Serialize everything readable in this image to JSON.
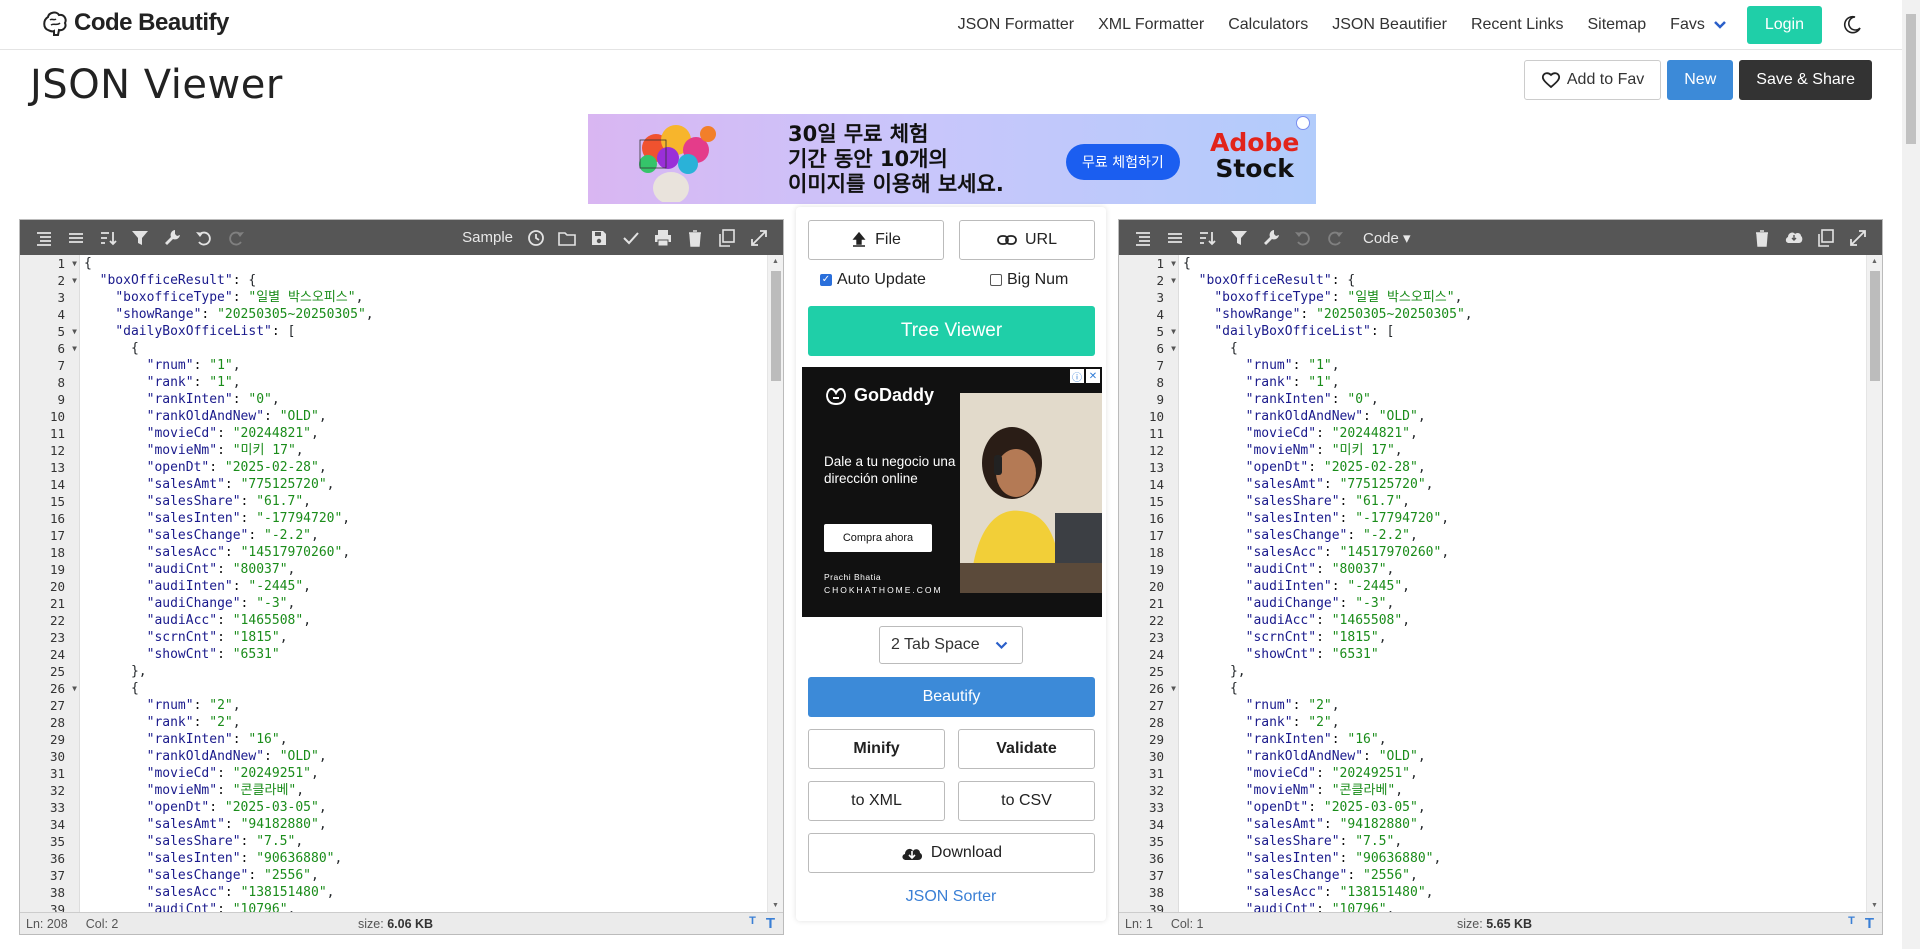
{
  "site": {
    "brand": "Code Beautify"
  },
  "nav": {
    "links": [
      "JSON Formatter",
      "XML Formatter",
      "Calculators",
      "JSON Beautifier",
      "Recent Links",
      "Sitemap"
    ],
    "favs": "Favs",
    "login": "Login"
  },
  "page": {
    "title": "JSON Viewer"
  },
  "actions": {
    "add_fav": "Add to Fav",
    "new": "New",
    "save_share": "Save & Share"
  },
  "ad_top": {
    "line1": "30일 무료 체험",
    "line2": "기간 동안 10개의",
    "line3": "이미지를 이용해 보세요.",
    "cta": "무료 체험하기",
    "brand1": "Adobe",
    "brand2": "Stock"
  },
  "left_editor": {
    "sample_label": "Sample",
    "status_ln": "Ln: 208",
    "status_col": "Col: 2",
    "size_label": "size: ",
    "size_value": "6.06 KB"
  },
  "right_editor": {
    "code_label": "Code ▾",
    "status_ln": "Ln: 1",
    "status_col": "Col: 1",
    "size_label": "size: ",
    "size_value": "5.65 KB"
  },
  "code_lines": [
    {
      "n": "1",
      "fold": true,
      "t": "{",
      "i": 0
    },
    {
      "n": "2",
      "fold": true,
      "t": "\"boxOfficeResult\": {",
      "i": 1
    },
    {
      "n": "3",
      "t": "\"boxofficeType\": \"일별 박스오피스\",",
      "i": 2
    },
    {
      "n": "4",
      "t": "\"showRange\": \"20250305~20250305\",",
      "i": 2
    },
    {
      "n": "5",
      "fold": true,
      "t": "\"dailyBoxOfficeList\": [",
      "i": 2
    },
    {
      "n": "6",
      "fold": true,
      "t": "{",
      "i": 3
    },
    {
      "n": "7",
      "t": "\"rnum\": \"1\",",
      "i": 4
    },
    {
      "n": "8",
      "t": "\"rank\": \"1\",",
      "i": 4
    },
    {
      "n": "9",
      "t": "\"rankInten\": \"0\",",
      "i": 4
    },
    {
      "n": "10",
      "t": "\"rankOldAndNew\": \"OLD\",",
      "i": 4
    },
    {
      "n": "11",
      "t": "\"movieCd\": \"20244821\",",
      "i": 4
    },
    {
      "n": "12",
      "t": "\"movieNm\": \"미키 17\",",
      "i": 4
    },
    {
      "n": "13",
      "t": "\"openDt\": \"2025-02-28\",",
      "i": 4
    },
    {
      "n": "14",
      "t": "\"salesAmt\": \"775125720\",",
      "i": 4
    },
    {
      "n": "15",
      "t": "\"salesShare\": \"61.7\",",
      "i": 4
    },
    {
      "n": "16",
      "t": "\"salesInten\": \"-17794720\",",
      "i": 4
    },
    {
      "n": "17",
      "t": "\"salesChange\": \"-2.2\",",
      "i": 4
    },
    {
      "n": "18",
      "t": "\"salesAcc\": \"14517970260\",",
      "i": 4
    },
    {
      "n": "19",
      "t": "\"audiCnt\": \"80037\",",
      "i": 4
    },
    {
      "n": "20",
      "t": "\"audiInten\": \"-2445\",",
      "i": 4
    },
    {
      "n": "21",
      "t": "\"audiChange\": \"-3\",",
      "i": 4
    },
    {
      "n": "22",
      "t": "\"audiAcc\": \"1465508\",",
      "i": 4
    },
    {
      "n": "23",
      "t": "\"scrnCnt\": \"1815\",",
      "i": 4
    },
    {
      "n": "24",
      "t": "\"showCnt\": \"6531\"",
      "i": 4
    },
    {
      "n": "25",
      "t": "},",
      "i": 3
    },
    {
      "n": "26",
      "fold": true,
      "t": "{",
      "i": 3
    },
    {
      "n": "27",
      "t": "\"rnum\": \"2\",",
      "i": 4
    },
    {
      "n": "28",
      "t": "\"rank\": \"2\",",
      "i": 4
    },
    {
      "n": "29",
      "t": "\"rankInten\": \"16\",",
      "i": 4
    },
    {
      "n": "30",
      "t": "\"rankOldAndNew\": \"OLD\",",
      "i": 4
    },
    {
      "n": "31",
      "t": "\"movieCd\": \"20249251\",",
      "i": 4
    },
    {
      "n": "32",
      "t": "\"movieNm\": \"콘클라베\",",
      "i": 4
    },
    {
      "n": "33",
      "t": "\"openDt\": \"2025-03-05\",",
      "i": 4
    },
    {
      "n": "34",
      "t": "\"salesAmt\": \"94182880\",",
      "i": 4
    },
    {
      "n": "35",
      "t": "\"salesShare\": \"7.5\",",
      "i": 4
    },
    {
      "n": "36",
      "t": "\"salesInten\": \"90636880\",",
      "i": 4
    },
    {
      "n": "37",
      "t": "\"salesChange\": \"2556\",",
      "i": 4
    },
    {
      "n": "38",
      "t": "\"salesAcc\": \"138151480\",",
      "i": 4
    },
    {
      "n": "39",
      "t": "\"audiCnt\": \"10796\",",
      "i": 4
    }
  ],
  "middle": {
    "file": "File",
    "url": "URL",
    "auto_update": "Auto Update",
    "big_num": "Big Num",
    "tree_viewer": "Tree Viewer",
    "tab_space": "2 Tab Space",
    "beautify": "Beautify",
    "minify": "Minify",
    "validate": "Validate",
    "to_xml": "to XML",
    "to_csv": "to CSV",
    "download": "Download",
    "json_sorter": "JSON Sorter"
  },
  "ad_side": {
    "brand": "GoDaddy",
    "text": "Dale a tu negocio una dirección online",
    "cta": "Compra ahora",
    "sign1": "Prachi Bhatia",
    "sign2": "CHOKHATHOME.COM"
  },
  "colors": {
    "accent": "#1fcfa8",
    "primary": "#3c8ad8",
    "dark": "#333333",
    "key": "#1a1a8c",
    "string": "#1a8c1a"
  }
}
